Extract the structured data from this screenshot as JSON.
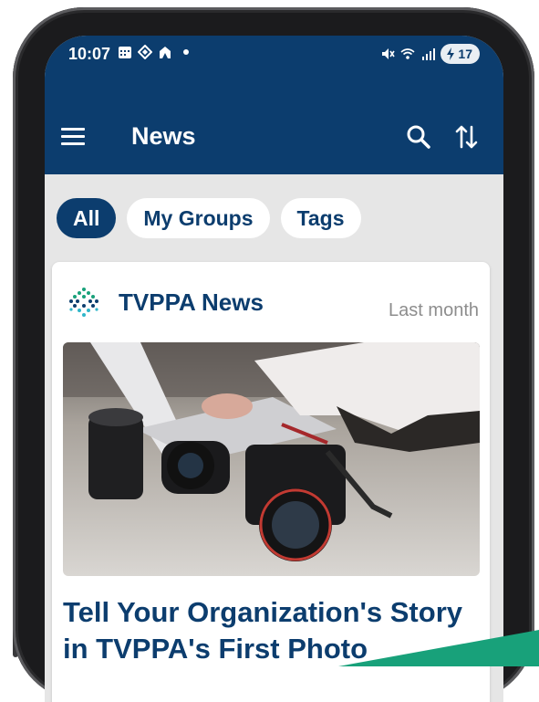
{
  "status_bar": {
    "time": "10:07",
    "battery": "17"
  },
  "app_bar": {
    "title": "News"
  },
  "filters": {
    "chips": [
      {
        "label": "All",
        "active": true
      },
      {
        "label": "My Groups",
        "active": false
      },
      {
        "label": "Tags",
        "active": false
      }
    ]
  },
  "news_card": {
    "source": "TVPPA News",
    "time": "Last month",
    "headline": "Tell Your Organization's Story in TVPPA's First Photo",
    "image_icon": "photo-cameras-on-desk"
  },
  "colors": {
    "primary": "#0c3d6e",
    "background": "#e6e6e6",
    "accent": "#18a17a",
    "muted": "#8d8d8d"
  }
}
